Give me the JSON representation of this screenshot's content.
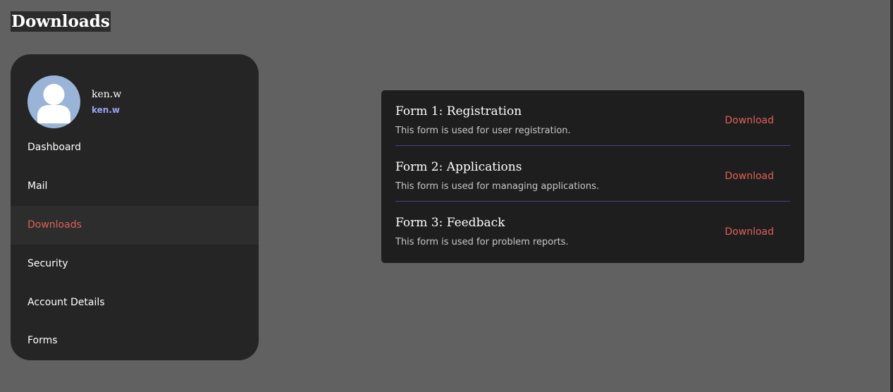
{
  "page": {
    "title": "Downloads"
  },
  "profile": {
    "name": "ken.w",
    "handle": "ken.w",
    "avatar_icon": "user-silhouette-icon"
  },
  "sidebar": {
    "items": [
      {
        "label": "Dashboard",
        "active": false
      },
      {
        "label": "Mail",
        "active": false
      },
      {
        "label": "Downloads",
        "active": true
      },
      {
        "label": "Security",
        "active": false
      },
      {
        "label": "Account Details",
        "active": false
      },
      {
        "label": "Forms",
        "active": false
      }
    ]
  },
  "forms": [
    {
      "title": "Form 1: Registration",
      "description": "This form is used for user registration.",
      "action": "Download"
    },
    {
      "title": "Form 2: Applications",
      "description": "This form is used for managing applications.",
      "action": "Download"
    },
    {
      "title": "Form 3: Feedback",
      "description": "This form is used for problem reports.",
      "action": "Download"
    }
  ],
  "colors": {
    "background": "#616161",
    "panel": "#252525",
    "card": "#1e1e1e",
    "accent": "#e0605a",
    "divider": "#4b3f8f",
    "handle": "#9aa3f0"
  }
}
